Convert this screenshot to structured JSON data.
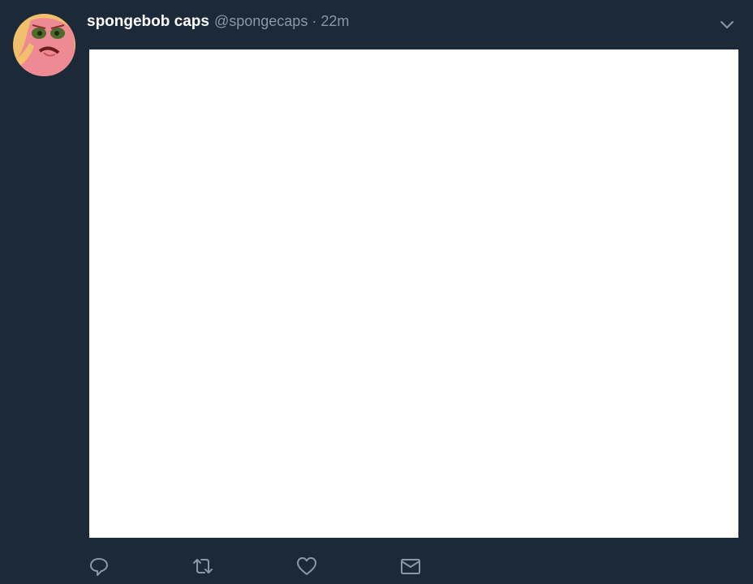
{
  "tweet": {
    "display_name": "spongebob caps",
    "handle": "@spongecaps",
    "separator": "·",
    "timestamp": "22m"
  },
  "icons": {
    "avatar": "patrick-star-avatar",
    "caret": "chevron-down-icon",
    "reply": "reply-icon",
    "retweet": "retweet-icon",
    "like": "heart-icon",
    "message": "direct-message-icon"
  },
  "colors": {
    "background": "#1c2938",
    "name": "#ffffff",
    "secondary": "#8899a6",
    "media": "#ffffff"
  }
}
